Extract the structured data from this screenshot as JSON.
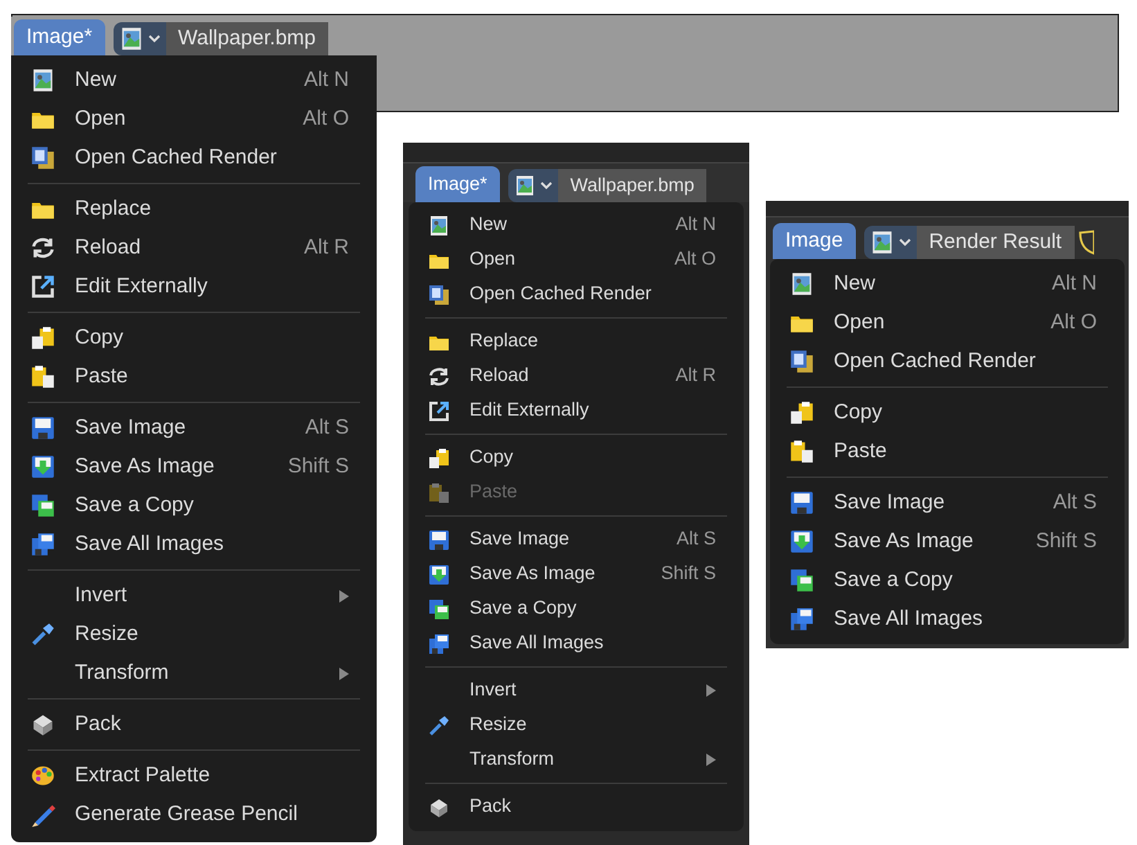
{
  "panels": [
    {
      "tab": {
        "label": "Image*",
        "selected": true
      },
      "file_name": "Wallpaper.bmp",
      "sections": [
        [
          {
            "kind": "new",
            "label": "New",
            "shortcut": "Alt N"
          },
          {
            "kind": "open",
            "label": "Open",
            "shortcut": "Alt O"
          },
          {
            "kind": "cached",
            "label": "Open Cached Render"
          }
        ],
        [
          {
            "kind": "open",
            "label": "Replace"
          },
          {
            "kind": "reload",
            "label": "Reload",
            "shortcut": "Alt R"
          },
          {
            "kind": "external",
            "label": "Edit Externally"
          }
        ],
        [
          {
            "kind": "copy",
            "label": "Copy"
          },
          {
            "kind": "paste",
            "label": "Paste",
            "disabled": false
          }
        ],
        [
          {
            "kind": "save",
            "label": "Save Image",
            "shortcut": "Alt S"
          },
          {
            "kind": "save_as",
            "label": "Save As Image",
            "shortcut": "Shift S"
          },
          {
            "kind": "save_copy",
            "label": "Save a Copy"
          },
          {
            "kind": "save_all",
            "label": "Save All Images"
          }
        ],
        [
          {
            "kind": "plain",
            "label": "Invert",
            "submenu": true
          },
          {
            "kind": "resize",
            "label": "Resize"
          },
          {
            "kind": "plain",
            "label": "Transform",
            "submenu": true
          }
        ],
        [
          {
            "kind": "pack",
            "label": "Pack"
          }
        ],
        [
          {
            "kind": "palette",
            "label": "Extract Palette"
          },
          {
            "kind": "pencil",
            "label": "Generate Grease Pencil"
          }
        ]
      ]
    },
    {
      "tab": {
        "label": "Image*",
        "selected": true
      },
      "file_name": "Wallpaper.bmp",
      "sections": [
        [
          {
            "kind": "new",
            "label": "New",
            "shortcut": "Alt N"
          },
          {
            "kind": "open",
            "label": "Open",
            "shortcut": "Alt O"
          },
          {
            "kind": "cached",
            "label": "Open Cached Render"
          }
        ],
        [
          {
            "kind": "open",
            "label": "Replace"
          },
          {
            "kind": "reload",
            "label": "Reload",
            "shortcut": "Alt R"
          },
          {
            "kind": "external",
            "label": "Edit Externally"
          }
        ],
        [
          {
            "kind": "copy",
            "label": "Copy"
          },
          {
            "kind": "paste",
            "label": "Paste",
            "disabled": true
          }
        ],
        [
          {
            "kind": "save",
            "label": "Save Image",
            "shortcut": "Alt S"
          },
          {
            "kind": "save_as",
            "label": "Save As Image",
            "shortcut": "Shift S"
          },
          {
            "kind": "save_copy",
            "label": "Save a Copy"
          },
          {
            "kind": "save_all",
            "label": "Save All Images"
          }
        ],
        [
          {
            "kind": "plain",
            "label": "Invert",
            "submenu": true
          },
          {
            "kind": "resize",
            "label": "Resize"
          },
          {
            "kind": "plain",
            "label": "Transform",
            "submenu": true
          }
        ],
        [
          {
            "kind": "pack",
            "label": "Pack"
          }
        ]
      ]
    },
    {
      "tab": {
        "label": "Image",
        "selected": true
      },
      "file_name": "Render Result",
      "sections": [
        [
          {
            "kind": "new",
            "label": "New",
            "shortcut": "Alt N"
          },
          {
            "kind": "open",
            "label": "Open",
            "shortcut": "Alt O"
          },
          {
            "kind": "cached",
            "label": "Open Cached Render"
          }
        ],
        [
          {
            "kind": "copy",
            "label": "Copy"
          },
          {
            "kind": "paste",
            "label": "Paste",
            "disabled": false
          }
        ],
        [
          {
            "kind": "save",
            "label": "Save Image",
            "shortcut": "Alt S"
          },
          {
            "kind": "save_as",
            "label": "Save As Image",
            "shortcut": "Shift S"
          },
          {
            "kind": "save_copy",
            "label": "Save a Copy"
          },
          {
            "kind": "save_all",
            "label": "Save All Images"
          }
        ]
      ]
    }
  ]
}
